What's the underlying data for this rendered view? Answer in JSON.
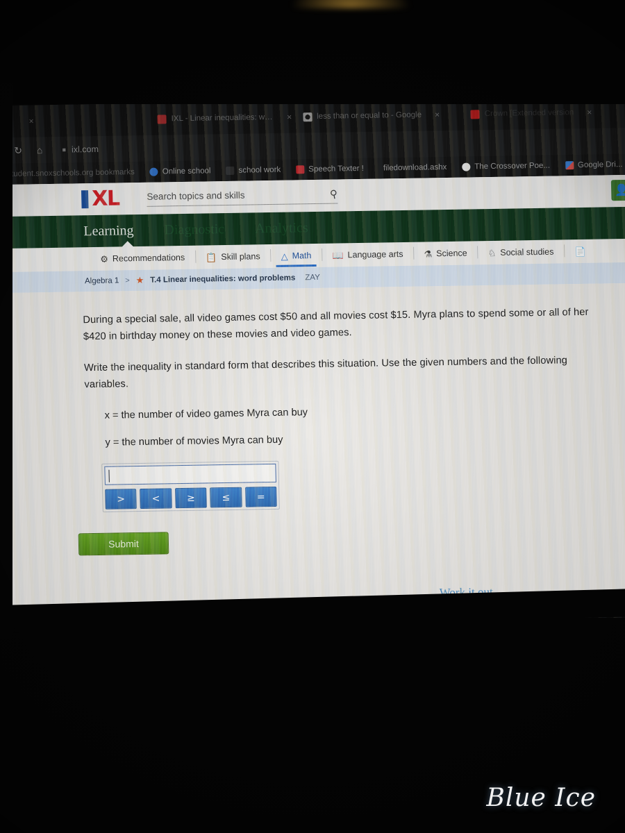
{
  "browser": {
    "tabs": [
      {
        "title": "",
        "favicon": "blank-favicon",
        "dim": true
      },
      {
        "title": "IXL - Linear inequalities: word",
        "favicon": "ixl-favicon",
        "dim": false
      },
      {
        "title": "less than or equal to - Google",
        "favicon": "google-favicon",
        "dim": false
      },
      {
        "title": "Crown [Extended version",
        "favicon": "youtube-favicon",
        "dim": true
      }
    ],
    "close_label": "×",
    "reload_label": "↻",
    "home_label": "⌂",
    "address": {
      "url": "ixl.com",
      "lock": "■"
    },
    "bookmarks": [
      {
        "label": "student.snoxschools.org bookmarks",
        "icon": "folder-icon"
      },
      {
        "label": "Online school",
        "icon": "blue-circle-icon"
      },
      {
        "label": "school work",
        "icon": "page-icon"
      },
      {
        "label": "Speech Texter !",
        "icon": "red-app-icon"
      },
      {
        "label": "filedownload.ashx",
        "icon": "no-icon"
      },
      {
        "label": "The Crossover Poe...",
        "icon": "globe-icon"
      },
      {
        "label": "Google Dri...",
        "icon": "drive-icon"
      }
    ]
  },
  "ixl": {
    "logo": {
      "mark": "XL",
      "name": "ixl-logo"
    },
    "search": {
      "placeholder": "Search topics and skills",
      "icon": "search-icon"
    },
    "account_icon": "user-avatar-icon",
    "main_nav": [
      {
        "label": "Learning",
        "active": true
      },
      {
        "label": "Diagnostic",
        "active": false
      },
      {
        "label": "Analytics",
        "active": false
      }
    ],
    "subject_tabs": [
      {
        "label": "Recommendations",
        "icon": "recommendations-icon",
        "active": false
      },
      {
        "label": "Skill plans",
        "icon": "skill-plans-icon",
        "active": false
      },
      {
        "label": "Math",
        "icon": "math-icon",
        "active": true
      },
      {
        "label": "Language arts",
        "icon": "book-icon",
        "active": false
      },
      {
        "label": "Science",
        "icon": "flask-icon",
        "active": false
      },
      {
        "label": "Social studies",
        "icon": "globe-tree-icon",
        "active": false
      },
      {
        "label": "",
        "icon": "partial-icon",
        "active": false
      }
    ],
    "breadcrumb": {
      "course": "Algebra 1",
      "separator": ">",
      "star_icon": "star-icon",
      "skill": "T.4 Linear inequalities: word problems",
      "user": "ZAY"
    }
  },
  "question": {
    "paragraph1": "During a special sale, all video games cost $50 and all movies cost $15. Myra plans to spend some or all of her $420 in birthday money on these movies and video games.",
    "paragraph2": "Write the inequality in standard form that describes this situation. Use the given numbers and the following variables.",
    "variable_x": "x = the number of video games Myra can buy",
    "variable_y": "y = the number of movies Myra can buy",
    "answer_value": "",
    "symbol_buttons": [
      ">",
      "<",
      "≥",
      "≤",
      "="
    ],
    "submit_label": "Submit",
    "work_it_out": "Work it out"
  },
  "watermark": {
    "text": "Blue Ice"
  },
  "colors": {
    "ixl_green": "#10351c",
    "ixl_red": "#d11f26",
    "ixl_blue": "#1c4f9c",
    "submit_green": "#528b18",
    "symbol_blue": "#2f6cb3",
    "breadcrumb_bg": "#d7e2ef",
    "work_it_out_blue": "#4f91c6"
  }
}
